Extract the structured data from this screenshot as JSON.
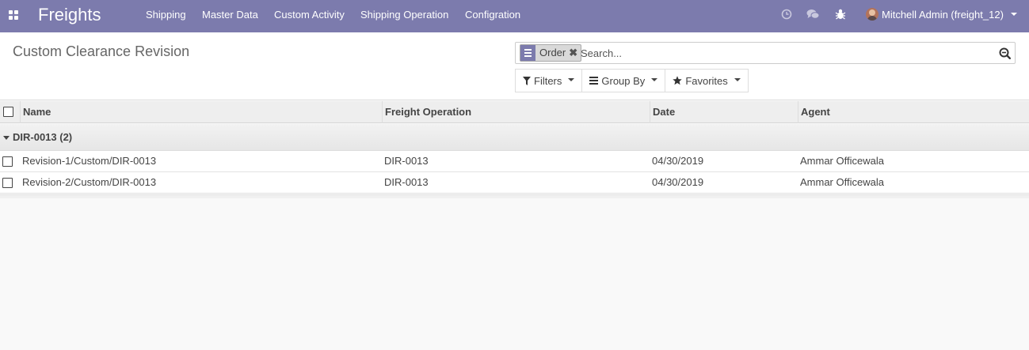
{
  "navbar": {
    "brand": "Freights",
    "menu": [
      "Shipping",
      "Master Data",
      "Custom Activity",
      "Shipping Operation",
      "Configration"
    ],
    "icons": [
      "clock-icon",
      "chat-icon",
      "bug-icon"
    ],
    "user": "Mitchell Admin (freight_12)",
    "color": "#7c7bad"
  },
  "control_panel": {
    "title": "Custom Clearance Revision",
    "search": {
      "facet_label": "Order",
      "placeholder": "Search..."
    },
    "buttons": {
      "filters": "Filters",
      "group_by": "Group By",
      "favorites": "Favorites"
    }
  },
  "list": {
    "columns": [
      "Name",
      "Freight Operation",
      "Date",
      "Agent"
    ],
    "group": {
      "label": "DIR-0013 (2)"
    },
    "rows": [
      {
        "name": "Revision-1/Custom/DIR-0013",
        "freight_operation": "DIR-0013",
        "date": "04/30/2019",
        "agent": "Ammar Officewala"
      },
      {
        "name": "Revision-2/Custom/DIR-0013",
        "freight_operation": "DIR-0013",
        "date": "04/30/2019",
        "agent": "Ammar Officewala"
      }
    ]
  }
}
